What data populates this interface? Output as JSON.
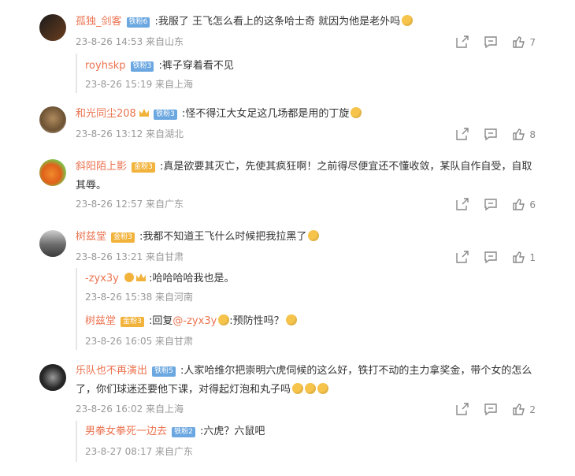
{
  "comments": [
    {
      "id": "c1",
      "user": "孤独_剑客",
      "badge": "铁粉6",
      "text": ":我服了 王飞怎么看上的这条哈士奇 就因为他是老外吗",
      "meta": "23-8-26 14:53 来自山东",
      "likes": "7",
      "replies": [
        {
          "user": "royhskp",
          "badge": "铁粉3",
          "text": ":裤子穿着看不见",
          "meta": "23-8-26 15:19 来自上海"
        }
      ]
    },
    {
      "id": "c2",
      "user": "和光同尘208",
      "badge": "铁粉3",
      "text": ":怪不得江大女足这几场都是用的丁旋",
      "meta": "23-8-26 13:12 来自湖北",
      "likes": "8"
    },
    {
      "id": "c3",
      "user": "斜阳陌上影",
      "badge": "金粉3",
      "text": ":真是欲要其灭亡，先使其疯狂啊！之前得尽便宜还不懂收敛，某队自作自受，自取其辱。",
      "meta": "23-8-26 12:57 来自广东",
      "likes": "6"
    },
    {
      "id": "c4",
      "user": "树兹堂",
      "badge": "金粉3",
      "text": ":我都不知道王飞什么时候把我拉黑了",
      "meta": "23-8-26 13:21 来自甘肃",
      "likes": "1",
      "replies": [
        {
          "user": "-zyx3y",
          "text": ":哈哈哈哈我也是。",
          "meta": "23-8-26 15:38 来自河南"
        },
        {
          "user": "树兹堂",
          "badge": "金粉3",
          "text_prefix": ":回复",
          "mention": "@-zyx3y",
          "text": ":预防性吗？",
          "meta": "23-8-26 16:05 来自甘肃"
        }
      ]
    },
    {
      "id": "c5",
      "user": "乐队也不再演出",
      "badge": "铁粉5",
      "text": ":人家哈维尔把崇明六虎伺候的这么好，铁打不动的主力拿奖金，带个女的怎么了，你们球迷还要他下课，对得起灯泡和丸子吗",
      "meta": "23-8-26 16:02 来自上海",
      "likes": "2",
      "replies": [
        {
          "user": "男拳女拳死一边去",
          "badge": "铁粉2",
          "text": ":六虎？六鼠吧",
          "meta": "23-8-27 08:17 来自广东"
        }
      ]
    }
  ],
  "icons": {
    "share": "share-icon",
    "comment": "comment-icon",
    "like": "like-icon"
  }
}
